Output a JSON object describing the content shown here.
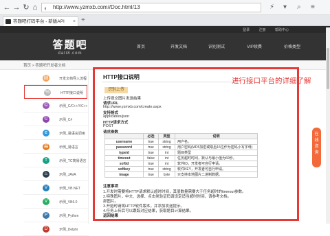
{
  "browser": {
    "url": "http://www.yzmxb.com//Doc.html/13",
    "tab_title": "答题吧打码平台 - 新版API",
    "new_tab": "+",
    "tab_close": "×"
  },
  "site": {
    "top_links": [
      "登录",
      "注册",
      "帮助中心"
    ],
    "logo_cn": "答题吧",
    "logo_en": "dati8.com",
    "nav": [
      "首页",
      "开发文档",
      "识别测试",
      "VIP续费",
      "价格类型"
    ],
    "breadcrumb": "首页 > 答题吧开发者文档"
  },
  "sidebar": {
    "items": [
      {
        "label": "开发文档导入流程",
        "icon": "doc-icon",
        "color": "#f0a35e"
      },
      {
        "label": "HTTP接口说明",
        "icon": "percent-icon",
        "color": "#bbbbbb"
      },
      {
        "label": "示例_C/C++/VC++",
        "icon": "c-icon",
        "color": "#9b59b6"
      },
      {
        "label": "示例_C#",
        "icon": "csharp-icon",
        "color": "#8e44ad"
      },
      {
        "label": "示例_易语言调用",
        "icon": "eyu-icon",
        "color": "#3498db"
      },
      {
        "label": "示例_易语言",
        "icon": "e-icon",
        "color": "#e67e22"
      },
      {
        "label": "示例_TC简易语言",
        "icon": "tc-icon",
        "color": "#16a085"
      },
      {
        "label": "示例_JAVA",
        "icon": "java-icon",
        "color": "#2c3e50"
      },
      {
        "label": "示例_VB.NET",
        "icon": "vbnet-icon",
        "color": "#2980b9"
      },
      {
        "label": "示例_VB6.0",
        "icon": "vb-icon",
        "color": "#27ae60"
      },
      {
        "label": "示例_Python",
        "icon": "python-icon",
        "color": "#3c78aa"
      },
      {
        "label": "示例_Delphi",
        "icon": "delphi-icon",
        "color": "#c0392b"
      }
    ]
  },
  "content": {
    "title": "HTTP接口说明",
    "badge": "识别上传",
    "lines": [
      "上传提交图片发送结果",
      "请求URL",
      "http://www.yzmxb.com/create.aspx",
      "支持格式",
      "application/json",
      "HTTP请求方式",
      "POST",
      "请求参数"
    ],
    "table_headers": [
      "",
      "必选",
      "类型",
      "说明"
    ],
    "table_rows": [
      {
        "name": "username",
        "req": "true",
        "type": "string",
        "desc": "用户名。"
      },
      {
        "name": "password",
        "req": "true",
        "type": "string",
        "desc": "用户密码(MD5加密或取后16位作为密码小写字母)"
      },
      {
        "name": "typeid",
        "req": "true",
        "type": "int",
        "desc": "题目类型"
      },
      {
        "name": "timeout",
        "req": "false",
        "type": "int",
        "desc": "任务超时时间，默认与最小值为60秒。"
      },
      {
        "name": "softid",
        "req": "true",
        "type": "int",
        "desc": "软件ID，开发者可自行申请。"
      },
      {
        "name": "softkey",
        "req": "true",
        "type": "string",
        "desc": "软件KEY，开发者可自行申请。"
      },
      {
        "name": "image",
        "req": "true",
        "type": "byte",
        "desc": "只支持本地图片二进制数据。"
      }
    ],
    "notes_title": "注意事项",
    "notes": [
      "1.开发时需要将HTTP请求默认超时时间，其值数量需要大于任务超时的timeout参数。",
      "2.特殊图片，中文、选择、点击类验证码请设定适当超时时间，请参考文档。",
      "   部图片。",
      "3.开始时请将HTTP软件版本，并添加发送提示。",
      "4.任务上传后可以跟踪对应结果，获取题目计算结果。",
      "返回结果"
    ]
  },
  "annotation": "进行接口平台的详细了解",
  "float_button": "在线咨询",
  "colors": {
    "highlight": "#e53935",
    "header_bg": "#333333",
    "float_btn": "#f26a3b"
  }
}
